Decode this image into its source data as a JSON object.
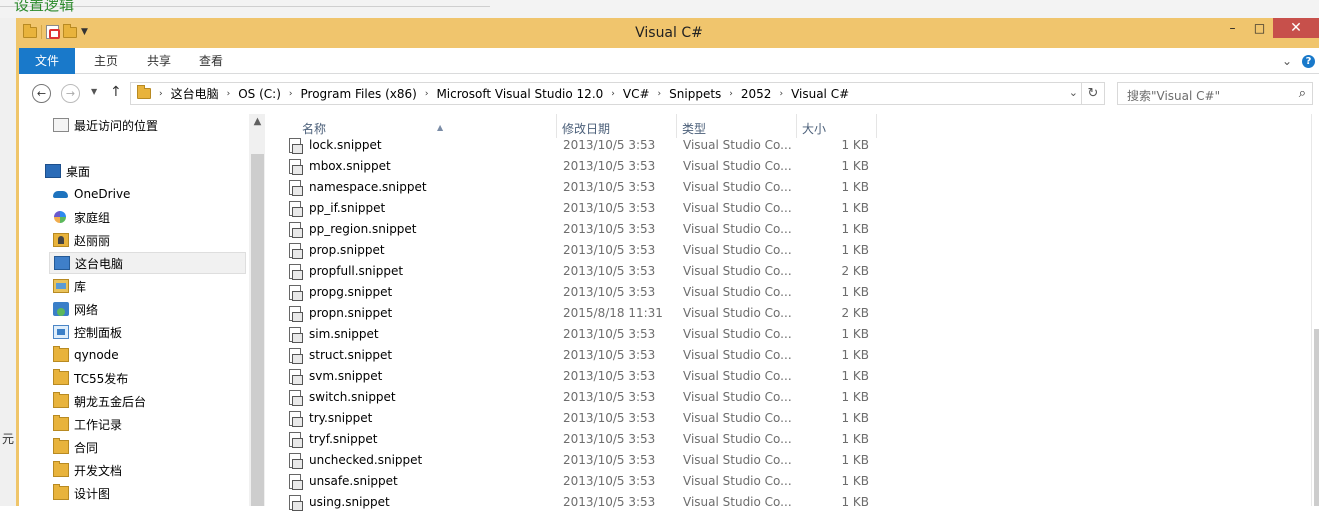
{
  "background": {
    "partial_text": "设置逻辑",
    "side_char": "元"
  },
  "window": {
    "title": "Visual C#",
    "controls": {
      "minimize": "–",
      "maximize": "□",
      "close": "✕"
    }
  },
  "ribbon": {
    "tabs": [
      "文件",
      "主页",
      "共享",
      "查看"
    ]
  },
  "address": {
    "crumbs": [
      "这台电脑",
      "OS (C:)",
      "Program Files (x86)",
      "Microsoft Visual Studio 12.0",
      "VC#",
      "Snippets",
      "2052",
      "Visual C#"
    ],
    "search_placeholder": "搜索\"Visual C#\""
  },
  "navpane": {
    "items": [
      {
        "label": "最近访问的位置",
        "icon": "recent-places-icon"
      },
      {
        "label": "桌面",
        "icon": "desktop-icon"
      },
      {
        "label": "OneDrive",
        "icon": "onedrive-icon"
      },
      {
        "label": "家庭组",
        "icon": "homegroup-icon"
      },
      {
        "label": "赵丽丽",
        "icon": "user-folder-icon"
      },
      {
        "label": "这台电脑",
        "icon": "this-pc-icon",
        "selected": true
      },
      {
        "label": "库",
        "icon": "libraries-icon"
      },
      {
        "label": "网络",
        "icon": "network-icon"
      },
      {
        "label": "控制面板",
        "icon": "control-panel-icon"
      },
      {
        "label": "qynode",
        "icon": "folder-icon"
      },
      {
        "label": "TC55发布",
        "icon": "folder-icon"
      },
      {
        "label": "朝龙五金后台",
        "icon": "folder-icon"
      },
      {
        "label": "工作记录",
        "icon": "folder-icon"
      },
      {
        "label": "合同",
        "icon": "folder-icon"
      },
      {
        "label": "开发文档",
        "icon": "folder-icon"
      },
      {
        "label": "设计图",
        "icon": "folder-icon"
      }
    ]
  },
  "columns": {
    "name": "名称",
    "date": "修改日期",
    "type": "类型",
    "size": "大小"
  },
  "files": [
    {
      "name": "lock.snippet",
      "date": "2013/10/5 3:53",
      "type": "Visual Studio Co...",
      "size": "1 KB"
    },
    {
      "name": "mbox.snippet",
      "date": "2013/10/5 3:53",
      "type": "Visual Studio Co...",
      "size": "1 KB"
    },
    {
      "name": "namespace.snippet",
      "date": "2013/10/5 3:53",
      "type": "Visual Studio Co...",
      "size": "1 KB"
    },
    {
      "name": "pp_if.snippet",
      "date": "2013/10/5 3:53",
      "type": "Visual Studio Co...",
      "size": "1 KB"
    },
    {
      "name": "pp_region.snippet",
      "date": "2013/10/5 3:53",
      "type": "Visual Studio Co...",
      "size": "1 KB"
    },
    {
      "name": "prop.snippet",
      "date": "2013/10/5 3:53",
      "type": "Visual Studio Co...",
      "size": "1 KB"
    },
    {
      "name": "propfull.snippet",
      "date": "2013/10/5 3:53",
      "type": "Visual Studio Co...",
      "size": "2 KB"
    },
    {
      "name": "propg.snippet",
      "date": "2013/10/5 3:53",
      "type": "Visual Studio Co...",
      "size": "1 KB"
    },
    {
      "name": "propn.snippet",
      "date": "2015/8/18 11:31",
      "type": "Visual Studio Co...",
      "size": "2 KB"
    },
    {
      "name": "sim.snippet",
      "date": "2013/10/5 3:53",
      "type": "Visual Studio Co...",
      "size": "1 KB"
    },
    {
      "name": "struct.snippet",
      "date": "2013/10/5 3:53",
      "type": "Visual Studio Co...",
      "size": "1 KB"
    },
    {
      "name": "svm.snippet",
      "date": "2013/10/5 3:53",
      "type": "Visual Studio Co...",
      "size": "1 KB"
    },
    {
      "name": "switch.snippet",
      "date": "2013/10/5 3:53",
      "type": "Visual Studio Co...",
      "size": "1 KB"
    },
    {
      "name": "try.snippet",
      "date": "2013/10/5 3:53",
      "type": "Visual Studio Co...",
      "size": "1 KB"
    },
    {
      "name": "tryf.snippet",
      "date": "2013/10/5 3:53",
      "type": "Visual Studio Co...",
      "size": "1 KB"
    },
    {
      "name": "unchecked.snippet",
      "date": "2013/10/5 3:53",
      "type": "Visual Studio Co...",
      "size": "1 KB"
    },
    {
      "name": "unsafe.snippet",
      "date": "2013/10/5 3:53",
      "type": "Visual Studio Co...",
      "size": "1 KB"
    },
    {
      "name": "using.snippet",
      "date": "2013/10/5 3:53",
      "type": "Visual Studio Co...",
      "size": "1 KB"
    }
  ],
  "colors": {
    "titlebar": "#f0c56d",
    "file_tab": "#1979ca",
    "close_button": "#c7504b"
  }
}
